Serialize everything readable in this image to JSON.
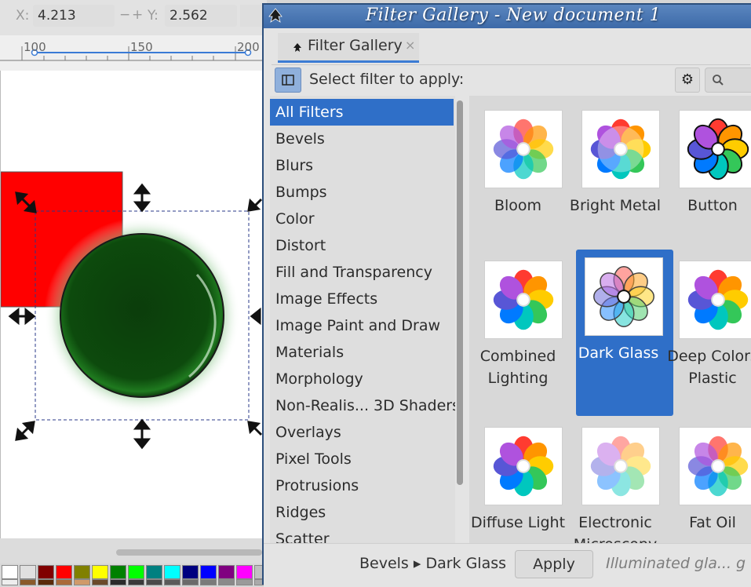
{
  "toolbar": {
    "x_label": "X:",
    "x_value": "4.213",
    "minus": "−",
    "plus": "+",
    "y_label": "Y:",
    "y_value": "2.562"
  },
  "ruler": {
    "ticks": [
      "100",
      "150",
      "200"
    ]
  },
  "palette": {
    "colors": [
      "#ffffff",
      "#e0e0e0",
      "#800000",
      "#ff0000",
      "#808000",
      "#ffff00",
      "#008000",
      "#00ff00",
      "#008080",
      "#00ffff",
      "#000080",
      "#0000ff",
      "#800080",
      "#ff00ff",
      "#c0c0c0"
    ]
  },
  "dialog": {
    "title": "Filter Gallery - New document 1",
    "tab_label": "Filter Gallery",
    "tab_close": "×",
    "select_label": "Select filter to apply:",
    "settings_icon": "gear-icon",
    "search_icon": "search-icon"
  },
  "categories": [
    {
      "label": "All Filters",
      "selected": true
    },
    {
      "label": "Bevels"
    },
    {
      "label": "Blurs"
    },
    {
      "label": "Bumps"
    },
    {
      "label": "Color"
    },
    {
      "label": "Distort"
    },
    {
      "label": "Fill and Transparency"
    },
    {
      "label": "Image Effects"
    },
    {
      "label": "Image Paint and Draw"
    },
    {
      "label": "Materials"
    },
    {
      "label": "Morphology"
    },
    {
      "label": "Non-Realis... 3D Shaders"
    },
    {
      "label": "Overlays"
    },
    {
      "label": "Pixel Tools"
    },
    {
      "label": "Protrusions"
    },
    {
      "label": "Ridges"
    },
    {
      "label": "Scatter"
    }
  ],
  "filters": [
    {
      "label": "Bloom",
      "style": "bloom"
    },
    {
      "label": "Bright Metal",
      "style": "metal"
    },
    {
      "label": "Button",
      "style": "button"
    },
    {
      "label": "Combined Lighting",
      "style": "plain"
    },
    {
      "label": "Dark Glass",
      "style": "glass",
      "selected": true
    },
    {
      "label": "Deep Colors Plastic",
      "style": "plastic"
    },
    {
      "label": "Diffuse Light",
      "style": "plain"
    },
    {
      "label": "Electronic Microscopy",
      "style": "micro"
    },
    {
      "label": "Fat Oil",
      "style": "oil"
    }
  ],
  "footer": {
    "breadcrumb": "Bevels ▸ Dark Glass",
    "apply_label": "Apply",
    "description": "Illuminated gla... g fr"
  }
}
